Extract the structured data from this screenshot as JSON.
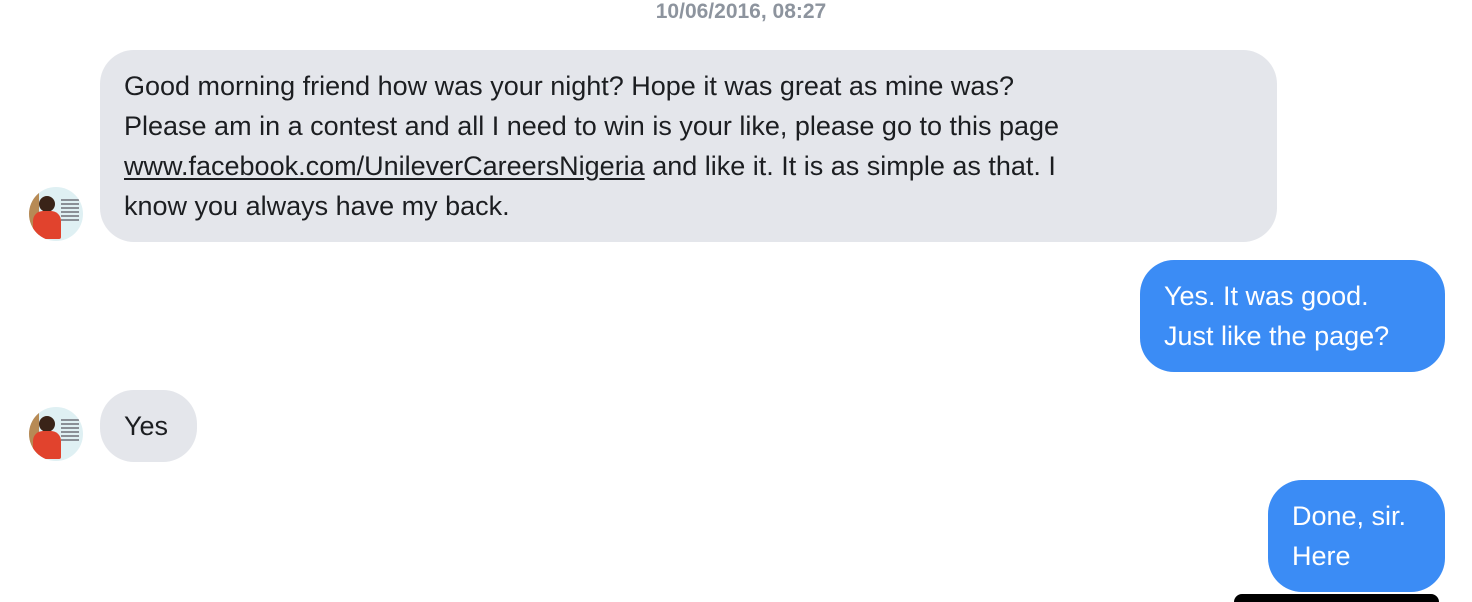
{
  "conversation": {
    "timestamp": "10/06/2016, 08:27",
    "messages": [
      {
        "direction": "incoming",
        "lines": [
          "Good morning friend how was your night? Hope it was great as mine was?",
          "Please am in a contest and all I need to win is your like, please go to this page",
          "and like it. It is as simple as that. I",
          "know you always have my back."
        ],
        "link": "www.facebook.com/UnileverCareersNigeria"
      },
      {
        "direction": "outgoing",
        "lines": [
          "Yes.  It was good.",
          "Just like the page?"
        ]
      },
      {
        "direction": "incoming",
        "text": "Yes"
      },
      {
        "direction": "outgoing",
        "lines": [
          "Done, sir.",
          "Here"
        ]
      }
    ]
  },
  "colors": {
    "incoming_bubble": "#e4e6eb",
    "outgoing_bubble": "#3b8cf5",
    "timestamp": "#8d949e"
  },
  "icons": {
    "avatar": "contact-avatar"
  }
}
